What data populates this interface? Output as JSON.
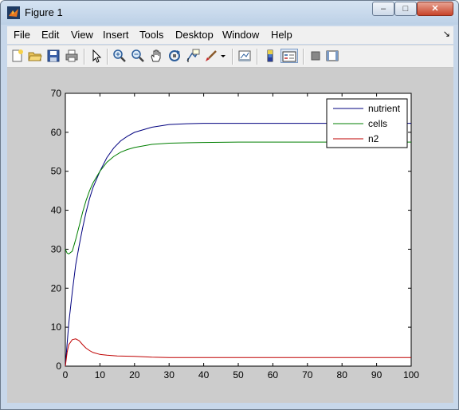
{
  "window": {
    "title": "Figure 1",
    "minimize_glyph": "–",
    "maximize_glyph": "□",
    "close_glyph": "✕"
  },
  "menu": {
    "items": [
      "File",
      "Edit",
      "View",
      "Insert",
      "Tools",
      "Desktop",
      "Window",
      "Help"
    ],
    "dock_arrow": "↘"
  },
  "toolbar": {
    "icons": [
      "new-figure-icon",
      "open-file-icon",
      "save-icon",
      "print-icon",
      "pointer-icon",
      "zoom-in-icon",
      "zoom-out-icon",
      "pan-hand-icon",
      "rotate-3d-icon",
      "data-cursor-icon",
      "brush-icon",
      "brush-dropdown-icon",
      "link-plot-icon",
      "colorbar-icon",
      "legend-icon",
      "hide-plot-tools-icon",
      "show-plot-tools-icon"
    ]
  },
  "colors": {
    "background": "#cccccc",
    "axes": "#ffffff",
    "nutrient": "#00007f",
    "cells": "#007f00",
    "n2": "#bf0000"
  },
  "chart_data": {
    "type": "line",
    "xlim": [
      0,
      100
    ],
    "ylim": [
      0,
      70
    ],
    "xticks": [
      0,
      10,
      20,
      30,
      40,
      50,
      60,
      70,
      80,
      90,
      100
    ],
    "yticks": [
      0,
      10,
      20,
      30,
      40,
      50,
      60,
      70
    ],
    "grid": false,
    "legend_position": "top-right",
    "series": [
      {
        "name": "nutrient",
        "color": "#00007f",
        "x": [
          0,
          1,
          2,
          3,
          4,
          5,
          6,
          7,
          8,
          10,
          12,
          14,
          16,
          18,
          20,
          25,
          30,
          35,
          40,
          50,
          60,
          70,
          80,
          90,
          100
        ],
        "y": [
          0,
          11,
          19,
          26,
          31,
          35.5,
          39.5,
          43,
          45.8,
          50,
          53.5,
          56,
          57.8,
          59,
          60,
          61.3,
          62,
          62.2,
          62.3,
          62.3,
          62.3,
          62.3,
          62.3,
          62.3,
          62.3
        ]
      },
      {
        "name": "cells",
        "color": "#007f00",
        "x": [
          0,
          0.5,
          1,
          2,
          3,
          4,
          5,
          6,
          7,
          8,
          10,
          12,
          14,
          16,
          18,
          20,
          25,
          30,
          35,
          40,
          50,
          60,
          70,
          80,
          90,
          100
        ],
        "y": [
          30,
          29,
          28.8,
          29.5,
          32.5,
          36,
          39.5,
          42.5,
          45,
          47,
          50,
          52.3,
          53.8,
          54.9,
          55.6,
          56.1,
          56.9,
          57.2,
          57.3,
          57.4,
          57.5,
          57.5,
          57.5,
          57.5,
          57.5,
          57.5
        ]
      },
      {
        "name": "n2",
        "color": "#bf0000",
        "x": [
          0,
          0.5,
          1,
          2,
          3,
          4,
          5,
          6,
          7,
          8,
          10,
          12,
          15,
          20,
          25,
          30,
          40,
          50,
          60,
          70,
          80,
          90,
          100
        ],
        "y": [
          0,
          3.5,
          5.5,
          6.8,
          7,
          6.5,
          5.5,
          4.6,
          4,
          3.5,
          3,
          2.8,
          2.6,
          2.5,
          2.3,
          2.2,
          2.2,
          2.2,
          2.2,
          2.2,
          2.2,
          2.2,
          2.2
        ]
      }
    ]
  }
}
